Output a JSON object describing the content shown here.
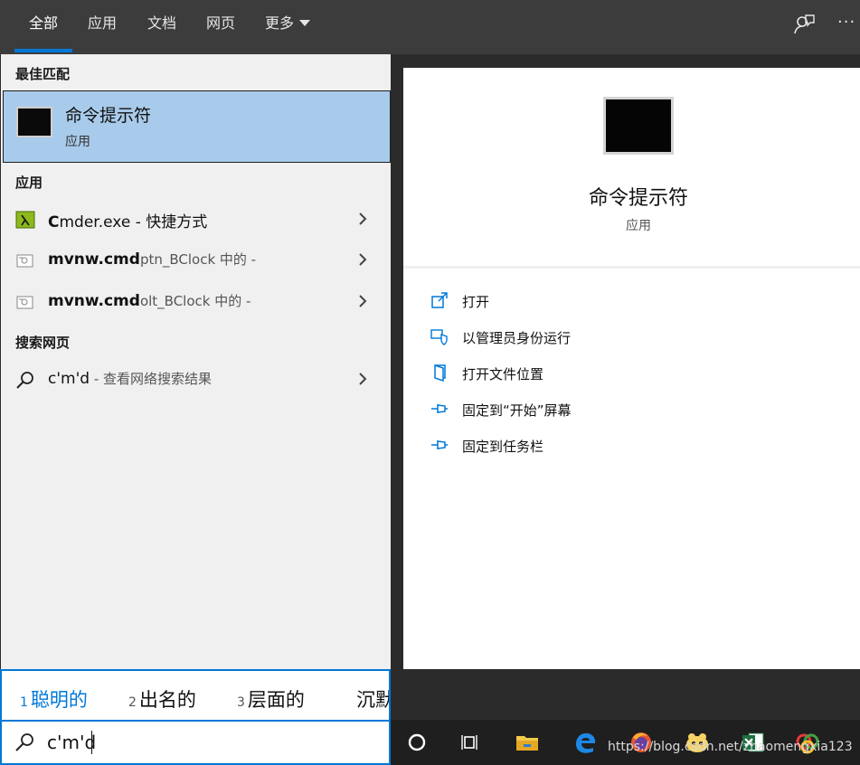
{
  "tabs": [
    {
      "label": "全部",
      "active": true
    },
    {
      "label": "应用",
      "active": false
    },
    {
      "label": "文档",
      "active": false
    },
    {
      "label": "网页",
      "active": false
    },
    {
      "label": "更多",
      "active": false
    }
  ],
  "top_right": {
    "more_options": "···"
  },
  "sections": {
    "best_match": "最佳匹配",
    "apps": "应用",
    "web": "搜索网页"
  },
  "best_match": {
    "title": "命令提示符",
    "subtitle": "应用"
  },
  "app_results": [
    {
      "bold": "C",
      "rest": "mder.exe",
      "suffix": " - 快捷方式"
    },
    {
      "bold": "mvnw.cmd",
      "rest": "",
      "suffix": "ptn_BClock 中的 -"
    },
    {
      "bold": "mvnw.cmd",
      "rest": "",
      "suffix": "olt_BClock 中的 -"
    }
  ],
  "web_result": {
    "query": "c'm'd",
    "suffix": " - 查看网络搜索结果"
  },
  "preview": {
    "title": "命令提示符",
    "subtitle": "应用"
  },
  "actions": [
    {
      "label": "打开",
      "icon": "open-icon"
    },
    {
      "label": "以管理员身份运行",
      "icon": "shield-icon"
    },
    {
      "label": "打开文件位置",
      "icon": "folder-location-icon"
    },
    {
      "label": "固定到“开始”屏幕",
      "icon": "pin-icon"
    },
    {
      "label": "固定到任务栏",
      "icon": "pin-icon"
    }
  ],
  "ime_candidates": [
    {
      "num": "1",
      "text": "聪明的"
    },
    {
      "num": "2",
      "text": "出名的"
    },
    {
      "num": "3",
      "text": "层面的"
    },
    {
      "num": "",
      "text": "沉默"
    }
  ],
  "search": {
    "value": "c'm'd"
  },
  "watermark": "https://blog.csdn.net/zhaomengxia123",
  "colors": {
    "accent": "#0078d7",
    "selection": "#a9cbeb",
    "topbar": "#3c3c3c",
    "panel": "#f0f0f0"
  }
}
